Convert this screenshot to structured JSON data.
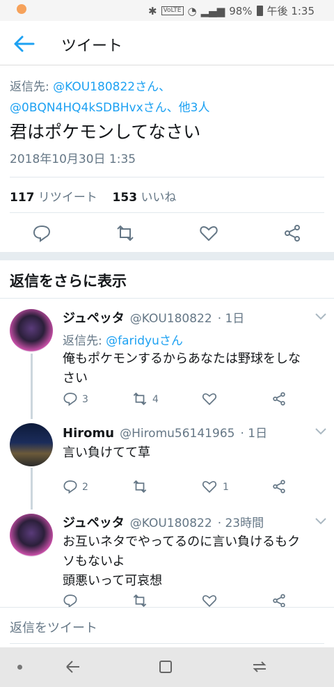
{
  "status": {
    "battery": "98%",
    "time": "午後 1:35",
    "network": "VoLTE"
  },
  "header": {
    "title": "ツイート"
  },
  "tweet": {
    "reply_prefix": "返信先:",
    "reply_line1_user": "@KOU180822さん、",
    "reply_line2": "@0BQN4HQ4kSDBHvxさん、他3人",
    "text": "君はポケモンしてなさい",
    "date": "2018年10月30日 1:35",
    "retweets": "117",
    "retweets_label": "リツイート",
    "likes": "153",
    "likes_label": "いいね"
  },
  "more_replies_title": "返信をさらに表示",
  "replies": [
    {
      "name": "ジュペッタ",
      "handle": "@KOU180822",
      "time": "· 1日",
      "reply_prefix": "返信先:",
      "reply_to": "@faridyuさん",
      "text1": "俺もポケモンするからあなたは野球をしな",
      "text2": "さい",
      "replies": "3",
      "retweets": "4",
      "likes": ""
    },
    {
      "name": "Hiromu",
      "handle": "@Hiromu56141965",
      "time": "· 1日",
      "text1": "言い負けてて草",
      "replies": "2",
      "retweets": "",
      "likes": "1"
    },
    {
      "name": "ジュペッタ",
      "handle": "@KOU180822",
      "time": "· 23時間",
      "text1": "お互いネタでやってるのに言い負けるもク",
      "text2": "ソもないよ",
      "text3": "頭悪いって可哀想"
    }
  ],
  "reply_bar": {
    "placeholder": "返信をツイート"
  },
  "colors": {
    "accent": "#1da1f2",
    "muted": "#657786"
  }
}
